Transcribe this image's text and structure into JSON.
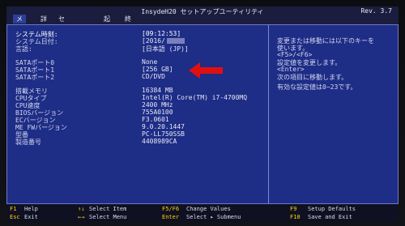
{
  "header": {
    "title": "InsydeH20 セットアップユーティリティ",
    "rev": "Rev. 3.7",
    "tabs": [
      "メイン",
      "詳細",
      "セキュリティ",
      "起動",
      "終了"
    ]
  },
  "main": {
    "rows": [
      {
        "label": "システム時刻:",
        "value": "[09:12:53]"
      },
      {
        "label": "システム日付:",
        "value": "[2016/"
      },
      {
        "label": "言語:",
        "value": "[日本語 (JP)]"
      },
      {
        "label": "SATAポート0",
        "value": "None"
      },
      {
        "label": "SATAポート1",
        "value": "[256 GB]"
      },
      {
        "label": "SATAポート2",
        "value": "CD/DVD"
      },
      {
        "label": "搭載メモリ",
        "value": "16384 MB"
      },
      {
        "label": "CPUタイプ",
        "value": "Intel(R) Core(TM) i7-4700MQ"
      },
      {
        "label": "CPU速度",
        "value": "2400 MHz"
      },
      {
        "label": "BIOSバージョン",
        "value": "755A0100"
      },
      {
        "label": "ECバージョン",
        "value": "F3.0601"
      },
      {
        "label": "ME FWバージョン",
        "value": "9.0.20.1447"
      },
      {
        "label": "型番",
        "value": "PC-LL750SSB"
      },
      {
        "label": "製造番号",
        "value": "4408989CA"
      }
    ]
  },
  "help": {
    "lines": [
      "変更または移動には以下のキーを",
      "使います。",
      "<F5>/<F6>",
      "  設定値を変更します。",
      "<Enter>",
      "  次の項目に移動します。",
      "",
      "有効な設定値は0~23です。"
    ]
  },
  "footer": {
    "items": [
      {
        "key": "F1",
        "desc": "Help"
      },
      {
        "key": "↑↓",
        "desc": "Select Item"
      },
      {
        "key": "F5/F6",
        "desc": "Change Values"
      },
      {
        "key": "F9",
        "desc": "Setup Defaults"
      },
      {
        "key": "Esc",
        "desc": "Exit"
      },
      {
        "key": "←→",
        "desc": "Select Menu"
      },
      {
        "key": "Enter",
        "desc": "Select ▸ Submenu"
      },
      {
        "key": "F10",
        "desc": "Save and Exit"
      }
    ]
  },
  "colors": {
    "panel": "#1e2d86",
    "active_tab": "#2b3f9a",
    "key_text": "#ffd700",
    "arrow": "#e01010"
  }
}
